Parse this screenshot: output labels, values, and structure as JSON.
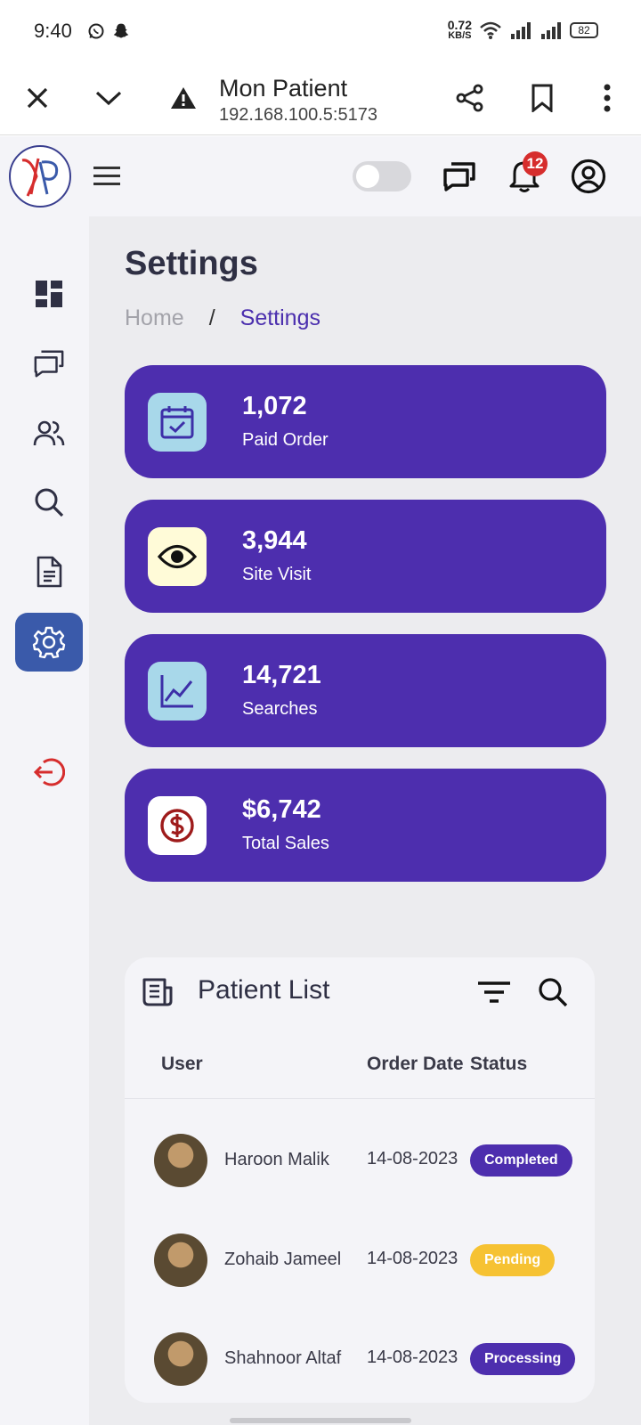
{
  "status_bar": {
    "time": "9:40",
    "net_speed_value": "0.72",
    "net_speed_unit": "KB/S",
    "battery": "82",
    "icons": [
      "whatsapp-icon",
      "snapchat-icon",
      "wifi-icon",
      "signal-icon",
      "signal-icon"
    ]
  },
  "browser": {
    "title": "Mon Patient",
    "url": "192.168.100.5:5173",
    "icons": [
      "close-icon",
      "chevron-down-icon",
      "warning-icon",
      "share-icon",
      "bookmark-icon",
      "more-vert-icon"
    ]
  },
  "header": {
    "logo": "VP",
    "notification_count": "12",
    "toggle_on": false,
    "icons": [
      "menu-icon",
      "chat-icon",
      "bell-icon",
      "user-circle-icon"
    ]
  },
  "sidebar": {
    "items": [
      {
        "name": "dashboard",
        "icon": "dashboard-icon",
        "active": false
      },
      {
        "name": "messages",
        "icon": "chat-icon",
        "active": false
      },
      {
        "name": "users",
        "icon": "users-icon",
        "active": false
      },
      {
        "name": "search",
        "icon": "search-icon",
        "active": false
      },
      {
        "name": "documents",
        "icon": "document-icon",
        "active": false
      },
      {
        "name": "settings",
        "icon": "gear-icon",
        "active": true
      },
      {
        "name": "logout",
        "icon": "logout-icon",
        "active": false
      }
    ]
  },
  "page": {
    "title": "Settings",
    "breadcrumb": {
      "home": "Home",
      "separator": "/",
      "current": "Settings"
    }
  },
  "stats": [
    {
      "value": "1,072",
      "label": "Paid Order",
      "icon": "calendar-check-icon",
      "icon_bg": "#a8d8ea"
    },
    {
      "value": "3,944",
      "label": "Site Visit",
      "icon": "eye-icon",
      "icon_bg": "#fffbd8"
    },
    {
      "value": "14,721",
      "label": "Searches",
      "icon": "line-chart-icon",
      "icon_bg": "#a8d8ea"
    },
    {
      "value": "$6,742",
      "label": "Total Sales",
      "icon": "dollar-icon",
      "icon_bg": "#ffffff"
    }
  ],
  "patient_list": {
    "title": "Patient List",
    "columns": [
      "User",
      "Order Date",
      "Status"
    ],
    "rows": [
      {
        "name": "Haroon Malik",
        "date": "14-08-2023",
        "status": "Completed",
        "status_color": "#4d2eae"
      },
      {
        "name": "Zohaib Jameel",
        "date": "14-08-2023",
        "status": "Pending",
        "status_color": "#f6c233"
      },
      {
        "name": "Shahnoor Altaf",
        "date": "14-08-2023",
        "status": "Processing",
        "status_color": "#4d2eae"
      }
    ]
  },
  "colors": {
    "accent": "#4d2eae",
    "sidebar_active": "#3a5aaa",
    "badge": "#d62d2d",
    "logout": "#d62d2d"
  }
}
